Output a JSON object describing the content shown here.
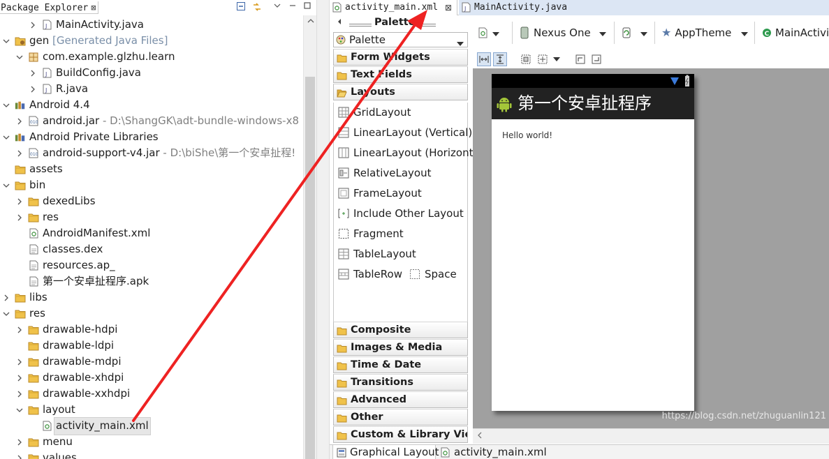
{
  "package_explorer": {
    "title": "Package Explorer",
    "close": "⊠",
    "tree": [
      {
        "label": "MainActivity.java",
        "deco": "",
        "icon": "java-file-icon",
        "chevron": "right",
        "indent": 3
      },
      {
        "label": "gen",
        "deco": "[Generated Java Files]",
        "icon": "gen-folder-icon",
        "chevron": "down",
        "indent": 1
      },
      {
        "label": "com.example.glzhu.learn",
        "deco": "",
        "icon": "package-icon",
        "chevron": "down",
        "indent": 2
      },
      {
        "label": "BuildConfig.java",
        "deco": "",
        "icon": "java-file-icon",
        "chevron": "right",
        "indent": 3
      },
      {
        "label": "R.java",
        "deco": "",
        "icon": "java-file-icon",
        "chevron": "right",
        "indent": 3
      },
      {
        "label": "Android 4.4",
        "deco": "",
        "icon": "library-icon",
        "chevron": "down",
        "indent": 1
      },
      {
        "label": "android.jar",
        "deco": " - D:\\ShangGK\\adt-bundle-windows-x8",
        "icon": "jar-icon",
        "chevron": "right",
        "indent": 2
      },
      {
        "label": "Android Private Libraries",
        "deco": "",
        "icon": "library-icon",
        "chevron": "down",
        "indent": 1
      },
      {
        "label": "android-support-v4.jar",
        "deco": " - D:\\biShe\\第一个安卓扯程!",
        "icon": "jar-icon",
        "chevron": "right",
        "indent": 2
      },
      {
        "label": "assets",
        "deco": "",
        "icon": "folder-icon",
        "chevron": "none",
        "indent": 1
      },
      {
        "label": "bin",
        "deco": "",
        "icon": "folder-icon",
        "chevron": "down",
        "indent": 1
      },
      {
        "label": "dexedLibs",
        "deco": "",
        "icon": "folder-icon",
        "chevron": "right",
        "indent": 2
      },
      {
        "label": "res",
        "deco": "",
        "icon": "folder-icon",
        "chevron": "right",
        "indent": 2
      },
      {
        "label": "AndroidManifest.xml",
        "deco": "",
        "icon": "xml-file-icon",
        "chevron": "none",
        "indent": 2
      },
      {
        "label": "classes.dex",
        "deco": "",
        "icon": "file-icon",
        "chevron": "none",
        "indent": 2
      },
      {
        "label": "resources.ap_",
        "deco": "",
        "icon": "file-icon",
        "chevron": "none",
        "indent": 2
      },
      {
        "label": "第一个安卓扯程序.apk",
        "deco": "",
        "icon": "file-icon",
        "chevron": "none",
        "indent": 2
      },
      {
        "label": "libs",
        "deco": "",
        "icon": "folder-icon",
        "chevron": "right",
        "indent": 1
      },
      {
        "label": "res",
        "deco": "",
        "icon": "folder-icon",
        "chevron": "down",
        "indent": 1
      },
      {
        "label": "drawable-hdpi",
        "deco": "",
        "icon": "folder-icon",
        "chevron": "right",
        "indent": 2
      },
      {
        "label": "drawable-ldpi",
        "deco": "",
        "icon": "folder-icon",
        "chevron": "none",
        "indent": 2
      },
      {
        "label": "drawable-mdpi",
        "deco": "",
        "icon": "folder-icon",
        "chevron": "right",
        "indent": 2
      },
      {
        "label": "drawable-xhdpi",
        "deco": "",
        "icon": "folder-icon",
        "chevron": "right",
        "indent": 2
      },
      {
        "label": "drawable-xxhdpi",
        "deco": "",
        "icon": "folder-icon",
        "chevron": "right",
        "indent": 2
      },
      {
        "label": "layout",
        "deco": "",
        "icon": "folder-icon",
        "chevron": "down",
        "indent": 2
      },
      {
        "label": "activity_main.xml",
        "deco": "",
        "icon": "xml-file-icon",
        "chevron": "none",
        "indent": 3,
        "selected": true
      },
      {
        "label": "menu",
        "deco": "",
        "icon": "folder-icon",
        "chevron": "right",
        "indent": 2
      },
      {
        "label": "values",
        "deco": "",
        "icon": "folder-icon",
        "chevron": "right",
        "indent": 2
      }
    ]
  },
  "editor": {
    "tabs": [
      {
        "label": "activity_main.xml",
        "close": "⊠",
        "active": true
      },
      {
        "label": "MainActivity.java",
        "active": false
      }
    ],
    "palette": {
      "title": "Palette",
      "selector": "Palette",
      "categories_top": [
        "Form Widgets",
        "Text Fields",
        "Layouts"
      ],
      "layout_items": [
        "GridLayout",
        "LinearLayout (Vertical)",
        "LinearLayout (Horizont",
        "RelativeLayout",
        "FrameLayout",
        "Include Other Layout",
        "Fragment",
        "TableLayout",
        "TableRow"
      ],
      "space_item": "Space",
      "categories_bottom": [
        "Composite",
        "Images & Media",
        "Time & Date",
        "Transitions",
        "Advanced",
        "Other",
        "Custom & Library Views"
      ]
    },
    "toolbar": {
      "device": "Nexus One",
      "theme": "AppTheme",
      "activity": "MainActivi"
    },
    "device_preview": {
      "app_title": "第一个安卓扯程序",
      "hello_text": "Hello world!"
    },
    "bottom_tabs": [
      "Graphical Layout",
      "activity_main.xml"
    ],
    "watermark": "https://blog.csdn.net/zhuguanlin121"
  },
  "colors": {
    "annotation_arrow": "#ee2222",
    "selection": "#e6e6e6",
    "action_bar": "#222222",
    "canvas": "#a0a0a0"
  }
}
